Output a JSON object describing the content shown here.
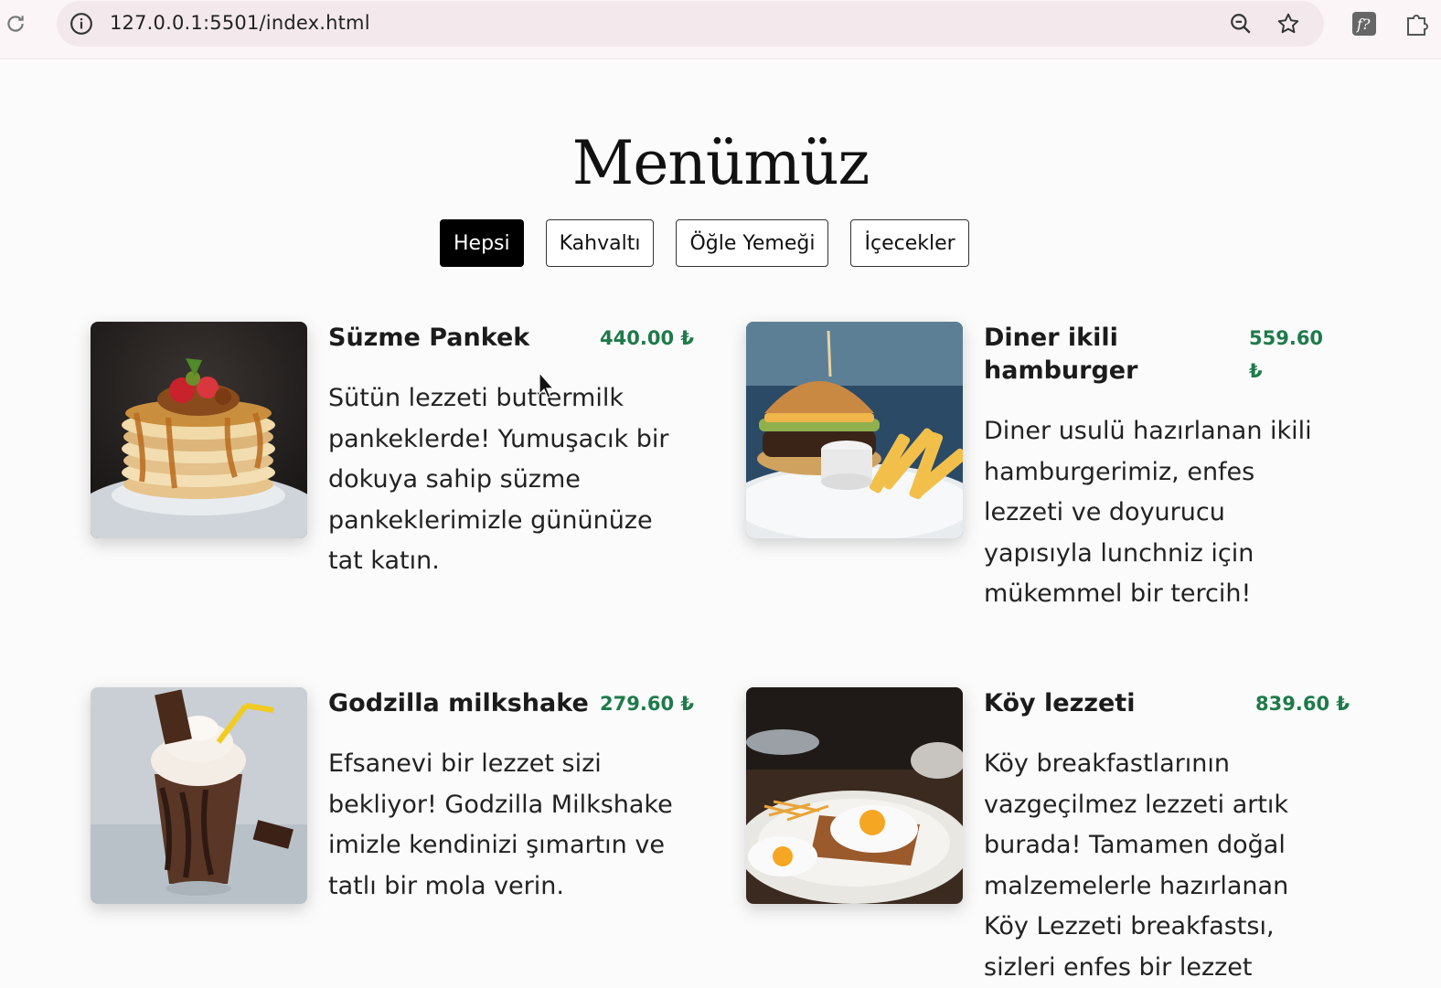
{
  "browser": {
    "url": "127.0.0.1:5501/index.html"
  },
  "page": {
    "title": "Menümüz",
    "filters": [
      "Hepsi",
      "Kahvaltı",
      "Öğle Yemeği",
      "İçecekler"
    ],
    "active_filter": "Hepsi"
  },
  "menu_items": [
    {
      "name": "Süzme Pankek",
      "price": "440.00 ₺",
      "description": "Sütün lezzeti buttermilk pankeklerde! Yumuşacık bir dokuya sahip süzme pankeklerimizle gününüze tat katın.",
      "image": "pancake-stack-photo"
    },
    {
      "name": "Diner ikili hamburger",
      "price": "559.60 ₺",
      "description": "Diner usulü hazırlanan ikili hamburgerimiz, enfes lezzeti ve doyurucu yapısıyla lunchniz için mükemmel bir tercih!",
      "image": "burger-fries-photo"
    },
    {
      "name": "Godzilla milkshake",
      "price": "279.60 ₺",
      "description": "Efsanevi bir lezzet sizi bekliyor! Godzilla Milkshake imizle kendinizi şımartın ve tatlı bir mola verin.",
      "image": "chocolate-milkshake-photo"
    },
    {
      "name": "Köy lezzeti",
      "price": "839.60 ₺",
      "description": "Köy breakfastlarının vazgeçilmez lezzeti artık burada! Tamamen doğal malzemelerle hazırlanan Köy Lezzeti breakfastsı, sizleri enfes bir lezzet",
      "image": "fried-eggs-breakfast-photo"
    }
  ],
  "colors": {
    "price": "#1e7a4a",
    "active_filter_bg": "#000000"
  }
}
